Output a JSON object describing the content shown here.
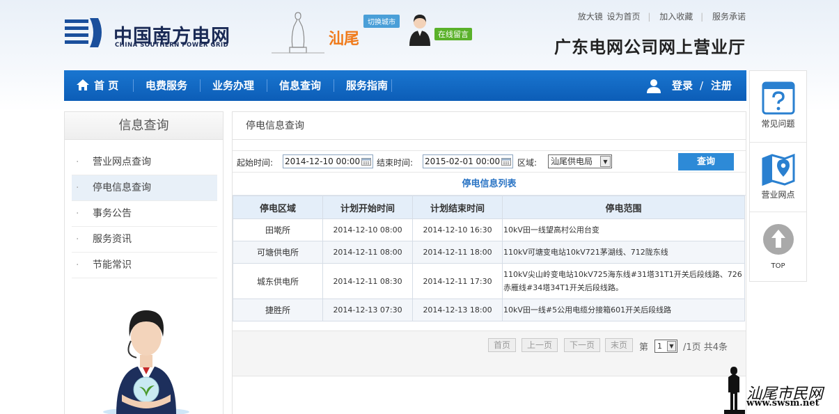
{
  "header": {
    "logo_cn": "中国南方电网",
    "logo_en": "CHINA SOUTHERN POWER GRID",
    "city": "汕尾",
    "switch_city": "切换城市",
    "online_message": "在线留言",
    "links": [
      "放大镜",
      "设为首页",
      "加入收藏",
      "服务承诺"
    ],
    "site_title": "广东电网公司网上营业厅"
  },
  "nav": {
    "items": [
      "首 页",
      "电费服务",
      "业务办理",
      "信息查询",
      "服务指南"
    ],
    "login": "登录",
    "slash": "/",
    "register": "注册"
  },
  "sidebar": {
    "title": "信息查询",
    "items": [
      "营业网点查询",
      "停电信息查询",
      "事务公告",
      "服务资讯",
      "节能常识"
    ],
    "active_index": 1
  },
  "main": {
    "title": "停电信息查询",
    "search": {
      "start_label": "起始时间:",
      "start_value": "2014-12-10 00:00",
      "end_label": "结束时间:",
      "end_value": "2015-02-01 00:00",
      "area_label": "区域:",
      "area_value": "汕尾供电局",
      "query_button": "查询"
    },
    "list_title": "停电信息列表",
    "columns": [
      "停电区域",
      "计划开始时间",
      "计划结束时间",
      "停电范围"
    ],
    "rows": [
      {
        "area": "田墘所",
        "start": "2014-12-10 08:00",
        "end": "2014-12-10 16:30",
        "range": "10kV田一线望高村公用台变"
      },
      {
        "area": "可塘供电所",
        "start": "2014-12-11 08:00",
        "end": "2014-12-11 18:00",
        "range": "110kV可塘变电站10kV721茅湖线、712陇东线"
      },
      {
        "area": "城东供电所",
        "start": "2014-12-11 08:30",
        "end": "2014-12-11 17:30",
        "range": "110kV尖山岭变电站10kV725海东线#31塔31T1开关后段线路、726赤雁线#34塔34T1开关后段线路。"
      },
      {
        "area": "捷胜所",
        "start": "2014-12-13 07:30",
        "end": "2014-12-13 18:00",
        "range": "10kV田一线#5公用电缆分接箱601开关后段线路"
      }
    ],
    "pager": {
      "first": "首页",
      "prev": "上一页",
      "next": "下一页",
      "last": "末页",
      "page_prefix": "第",
      "page_value": "1",
      "page_suffix": "/1页 共4条"
    }
  },
  "float_bar": {
    "faq": "常见问题",
    "outlets": "营业网点",
    "top": "TOP"
  },
  "watermark": {
    "text": "汕尾市民网",
    "url": "www.swsm.net"
  },
  "colors": {
    "nav_blue": "#0c5db7",
    "accent_blue": "#2d8ad7",
    "city_orange": "#f07a1a",
    "online_green": "#5ab12a"
  }
}
